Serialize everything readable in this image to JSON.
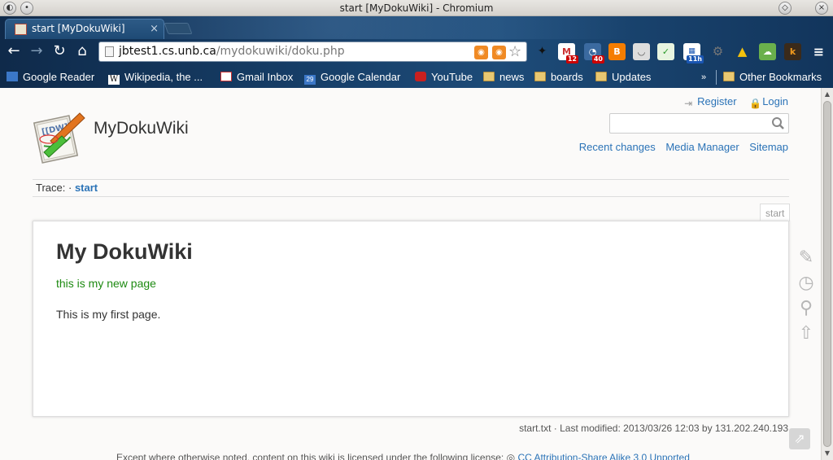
{
  "window": {
    "title": "start [MyDokuWiki] - Chromium"
  },
  "browser": {
    "tab_title": "start [MyDokuWiki]",
    "url_host": "jbtest1.cs.unb.ca",
    "url_path": "/mydokuwiki/doku.php",
    "extensions": [
      {
        "name": "bird-icon",
        "badge": ""
      },
      {
        "name": "gmail-icon",
        "badge": "12"
      },
      {
        "name": "feed-reader-icon",
        "badge": "40"
      },
      {
        "name": "blogger-icon",
        "badge": ""
      },
      {
        "name": "pocket-icon",
        "badge": ""
      },
      {
        "name": "checkmark-icon",
        "badge": ""
      },
      {
        "name": "calendar-icon",
        "badge": "11h"
      },
      {
        "name": "gear-icon",
        "badge": ""
      },
      {
        "name": "drive-icon",
        "badge": ""
      },
      {
        "name": "cloud-icon",
        "badge": ""
      },
      {
        "name": "k-icon",
        "badge": ""
      },
      {
        "name": "menu-icon",
        "badge": ""
      }
    ],
    "bookmarks": [
      {
        "label": "Google Reader",
        "icon": "google-reader-icon"
      },
      {
        "label": "Wikipedia, the ...",
        "icon": "wikipedia-icon"
      },
      {
        "label": "Gmail Inbox",
        "icon": "gmail-icon"
      },
      {
        "label": "Google Calendar",
        "icon": "calendar-icon",
        "badge": "29"
      },
      {
        "label": "YouTube",
        "icon": "youtube-icon"
      },
      {
        "label": "news",
        "icon": "folder-icon"
      },
      {
        "label": "boards",
        "icon": "folder-icon"
      },
      {
        "label": "Updates",
        "icon": "folder-icon"
      }
    ],
    "overflow_chevron": "»",
    "other_bookmarks": "Other Bookmarks"
  },
  "wiki": {
    "site_title": "MyDokuWiki",
    "user_tools": {
      "register": "Register",
      "login": "Login"
    },
    "search_placeholder": "",
    "site_tools": {
      "recent": "Recent changes",
      "media": "Media Manager",
      "sitemap": "Sitemap"
    },
    "trace_label": "Trace:",
    "trace_sep": "·",
    "trace_item": "start",
    "page_id": "start",
    "heading": "My DokuWiki",
    "green_text": "this is my new page",
    "body_text": "This is my first page.",
    "docinfo": "start.txt · Last modified: 2013/03/26 12:03 by 131.202.240.193",
    "license_prefix": "Except where otherwise noted, content on this wiki is licensed under the following license:",
    "license_link": "CC Attribution-Share Alike 3.0 Unported"
  }
}
